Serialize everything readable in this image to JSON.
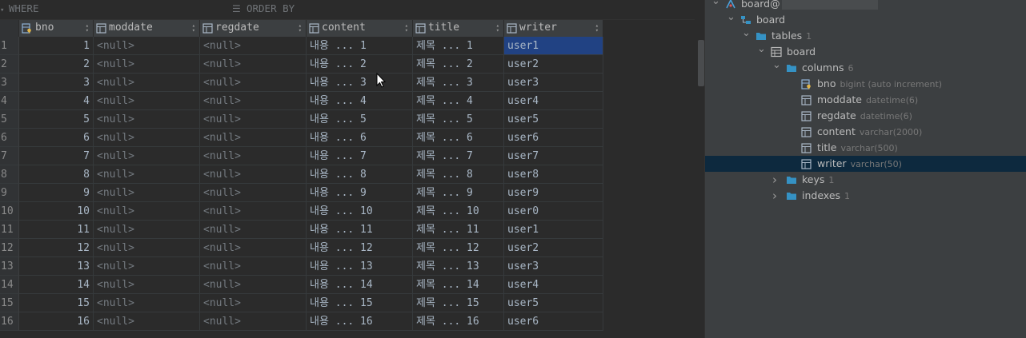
{
  "filters": {
    "where": "WHERE",
    "order_by": "ORDER BY"
  },
  "grid": {
    "columns": [
      {
        "name": "bno",
        "icon": "key-column-icon"
      },
      {
        "name": "moddate",
        "icon": "column-icon"
      },
      {
        "name": "regdate",
        "icon": "column-icon"
      },
      {
        "name": "content",
        "icon": "column-icon"
      },
      {
        "name": "title",
        "icon": "column-icon"
      },
      {
        "name": "writer",
        "icon": "column-icon"
      }
    ],
    "rows": [
      {
        "rownum": "1",
        "bno": "1",
        "moddate": "<null>",
        "regdate": "<null>",
        "content": "내용 ... 1",
        "title": "제목 ... 1",
        "writer": "user1"
      },
      {
        "rownum": "2",
        "bno": "2",
        "moddate": "<null>",
        "regdate": "<null>",
        "content": "내용 ... 2",
        "title": "제목 ... 2",
        "writer": "user2"
      },
      {
        "rownum": "3",
        "bno": "3",
        "moddate": "<null>",
        "regdate": "<null>",
        "content": "내용 ... 3",
        "title": "제목 ... 3",
        "writer": "user3"
      },
      {
        "rownum": "4",
        "bno": "4",
        "moddate": "<null>",
        "regdate": "<null>",
        "content": "내용 ... 4",
        "title": "제목 ... 4",
        "writer": "user4"
      },
      {
        "rownum": "5",
        "bno": "5",
        "moddate": "<null>",
        "regdate": "<null>",
        "content": "내용 ... 5",
        "title": "제목 ... 5",
        "writer": "user5"
      },
      {
        "rownum": "6",
        "bno": "6",
        "moddate": "<null>",
        "regdate": "<null>",
        "content": "내용 ... 6",
        "title": "제목 ... 6",
        "writer": "user6"
      },
      {
        "rownum": "7",
        "bno": "7",
        "moddate": "<null>",
        "regdate": "<null>",
        "content": "내용 ... 7",
        "title": "제목 ... 7",
        "writer": "user7"
      },
      {
        "rownum": "8",
        "bno": "8",
        "moddate": "<null>",
        "regdate": "<null>",
        "content": "내용 ... 8",
        "title": "제목 ... 8",
        "writer": "user8"
      },
      {
        "rownum": "9",
        "bno": "9",
        "moddate": "<null>",
        "regdate": "<null>",
        "content": "내용 ... 9",
        "title": "제목 ... 9",
        "writer": "user9"
      },
      {
        "rownum": "10",
        "bno": "10",
        "moddate": "<null>",
        "regdate": "<null>",
        "content": "내용 ... 10",
        "title": "제목 ... 10",
        "writer": "user0"
      },
      {
        "rownum": "11",
        "bno": "11",
        "moddate": "<null>",
        "regdate": "<null>",
        "content": "내용 ... 11",
        "title": "제목 ... 11",
        "writer": "user1"
      },
      {
        "rownum": "12",
        "bno": "12",
        "moddate": "<null>",
        "regdate": "<null>",
        "content": "내용 ... 12",
        "title": "제목 ... 12",
        "writer": "user2"
      },
      {
        "rownum": "13",
        "bno": "13",
        "moddate": "<null>",
        "regdate": "<null>",
        "content": "내용 ... 13",
        "title": "제목 ... 13",
        "writer": "user3"
      },
      {
        "rownum": "14",
        "bno": "14",
        "moddate": "<null>",
        "regdate": "<null>",
        "content": "내용 ... 14",
        "title": "제목 ... 14",
        "writer": "user4"
      },
      {
        "rownum": "15",
        "bno": "15",
        "moddate": "<null>",
        "regdate": "<null>",
        "content": "내용 ... 15",
        "title": "제목 ... 15",
        "writer": "user5"
      },
      {
        "rownum": "16",
        "bno": "16",
        "moddate": "<null>",
        "regdate": "<null>",
        "content": "내용 ... 16",
        "title": "제목 ... 16",
        "writer": "user6"
      }
    ],
    "selected_cell": {
      "row": 0,
      "column": "writer"
    }
  },
  "tree": {
    "nodes": [
      {
        "label": "board@",
        "meta": "",
        "icon": "datasource-icon",
        "expanded": true,
        "level": 0
      },
      {
        "label": "board",
        "meta": "",
        "icon": "schema-icon",
        "expanded": true,
        "level": 1
      },
      {
        "label": "tables",
        "meta": "1",
        "icon": "folder-icon",
        "expanded": true,
        "level": 2
      },
      {
        "label": "board",
        "meta": "",
        "icon": "table-icon",
        "expanded": true,
        "level": 3
      },
      {
        "label": "columns",
        "meta": "6",
        "icon": "folder-icon",
        "expanded": true,
        "level": 4
      },
      {
        "label": "bno",
        "meta": "bigint (auto increment)",
        "icon": "key-column-icon",
        "expanded": null,
        "level": 5
      },
      {
        "label": "moddate",
        "meta": "datetime(6)",
        "icon": "column-icon",
        "expanded": null,
        "level": 5
      },
      {
        "label": "regdate",
        "meta": "datetime(6)",
        "icon": "column-icon",
        "expanded": null,
        "level": 5
      },
      {
        "label": "content",
        "meta": "varchar(2000)",
        "icon": "column-icon",
        "expanded": null,
        "level": 5
      },
      {
        "label": "title",
        "meta": "varchar(500)",
        "icon": "column-icon",
        "expanded": null,
        "level": 5
      },
      {
        "label": "writer",
        "meta": "varchar(50)",
        "icon": "column-icon",
        "expanded": null,
        "level": 5,
        "selected": true
      },
      {
        "label": "keys",
        "meta": "1",
        "icon": "folder-icon",
        "expanded": false,
        "level": 4
      },
      {
        "label": "indexes",
        "meta": "1",
        "icon": "folder-icon",
        "expanded": false,
        "level": 4
      }
    ]
  },
  "colors": {
    "background": "#2b2b2b",
    "panel": "#3c3f41",
    "selection": "#214283",
    "tree_selection": "#0d293e",
    "folder": "#3592c4",
    "key": "#e0b54a"
  }
}
